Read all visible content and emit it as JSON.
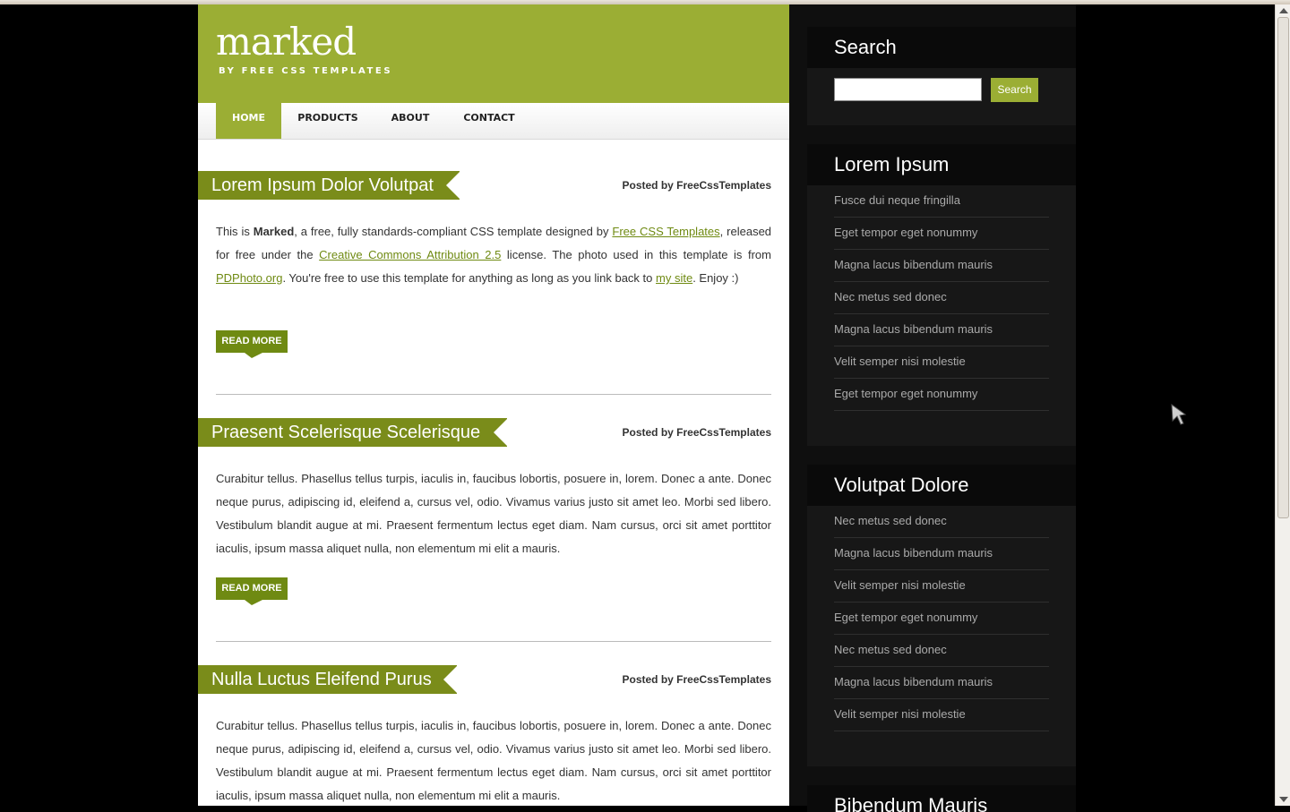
{
  "site": {
    "logo": "marked",
    "tagline": "BY FREE CSS TEMPLATES"
  },
  "menu": [
    {
      "label": "HOME",
      "active": true
    },
    {
      "label": "PRODUCTS",
      "active": false
    },
    {
      "label": "ABOUT",
      "active": false
    },
    {
      "label": "CONTACT",
      "active": false
    }
  ],
  "posts": [
    {
      "title": "Lorem Ipsum Dolor Volutpat",
      "byline": "Posted by FreeCssTemplates",
      "text_parts": {
        "p1": "This is ",
        "bold": "Marked",
        "p2": ", a free, fully standards-compliant CSS template designed by ",
        "link1": "Free CSS Templates",
        "p3": ", released for free under the ",
        "link2": "Creative Commons Attribution 2.5",
        "p4": " license. The photo used in this template is from ",
        "link3": "PDPhoto.org",
        "p5": ". You're free to use this template for anything as long as you link back to ",
        "link4": "my site",
        "p6": ". Enjoy :)"
      },
      "read_more": "READ MORE"
    },
    {
      "title": "Praesent Scelerisque Scelerisque",
      "byline": "Posted by FreeCssTemplates",
      "text": "Curabitur tellus. Phasellus tellus turpis, iaculis in, faucibus lobortis, posuere in, lorem. Donec a ante. Donec neque purus, adipiscing id, eleifend a, cursus vel, odio. Vivamus varius justo sit amet leo. Morbi sed libero. Vestibulum blandit augue at mi. Praesent fermentum lectus eget diam. Nam cursus, orci sit amet porttitor iaculis, ipsum massa aliquet nulla, non elementum mi elit a mauris.",
      "read_more": "READ MORE"
    },
    {
      "title": "Nulla Luctus Eleifend Purus",
      "byline": "Posted by FreeCssTemplates",
      "text": "Curabitur tellus. Phasellus tellus turpis, iaculis in, faucibus lobortis, posuere in, lorem. Donec a ante. Donec neque purus, adipiscing id, eleifend a, cursus vel, odio. Vivamus varius justo sit amet leo. Morbi sed libero. Vestibulum blandit augue at mi. Praesent fermentum lectus eget diam. Nam cursus, orci sit amet porttitor iaculis, ipsum massa aliquet nulla, non elementum mi elit a mauris."
    }
  ],
  "sidebar": {
    "search": {
      "title": "Search",
      "input_value": "",
      "button": "Search"
    },
    "boxes": [
      {
        "title": "Lorem Ipsum",
        "items": [
          "Fusce dui neque fringilla",
          "Eget tempor eget nonummy",
          "Magna lacus bibendum mauris",
          "Nec metus sed donec",
          "Magna lacus bibendum mauris",
          "Velit semper nisi molestie",
          "Eget tempor eget nonummy"
        ]
      },
      {
        "title": "Volutpat Dolore",
        "items": [
          "Nec metus sed donec",
          "Magna lacus bibendum mauris",
          "Velit semper nisi molestie",
          "Eget tempor eget nonummy",
          "Nec metus sed donec",
          "Magna lacus bibendum mauris",
          "Velit semper nisi molestie"
        ]
      },
      {
        "title": "Bibendum Mauris"
      }
    ]
  },
  "colors": {
    "accent": "#9bae34",
    "title_bg": "#7a8c1a",
    "sidebar_bg": "#0f0f0f",
    "page_bg": "#000000"
  },
  "icons": [
    "mouse-cursor-icon",
    "scroll-up-arrow-icon",
    "scroll-down-arrow-icon"
  ]
}
